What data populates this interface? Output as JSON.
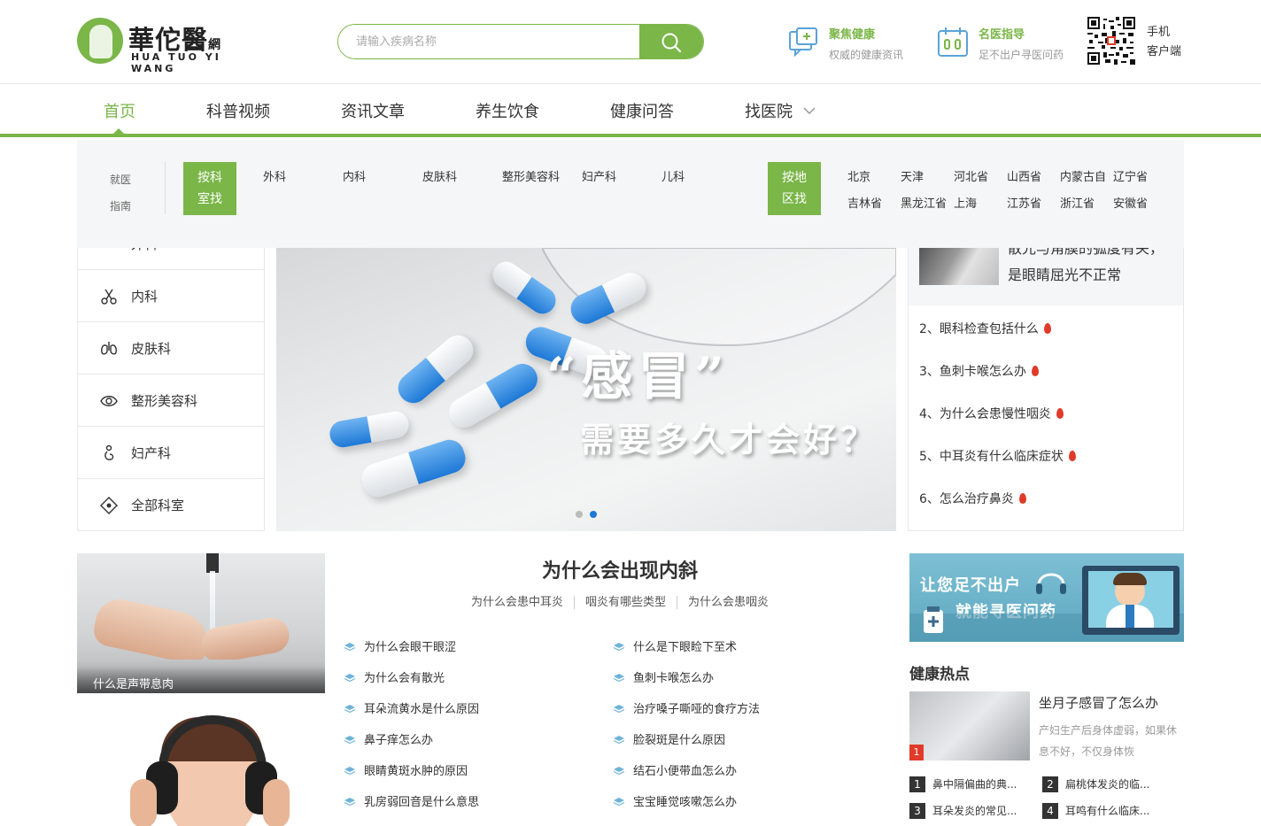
{
  "logo": {
    "cn": "華佗醫",
    "cn_suffix": "網",
    "en": "HUA TUO YI WANG"
  },
  "search": {
    "placeholder": "请输入疾病名称"
  },
  "header_features": [
    {
      "title": "聚焦健康",
      "subtitle": "权威的健康资讯"
    },
    {
      "title": "名医指导",
      "subtitle": "足不出户寻医问药"
    }
  ],
  "mobile": {
    "line1": "手机",
    "line2": "客户端"
  },
  "nav": {
    "items": [
      "首页",
      "科普视频",
      "资讯文章",
      "养生饮食",
      "健康问答",
      "找医院"
    ],
    "active_index": 0
  },
  "dropdown": {
    "guide_line1": "就医",
    "guide_line2": "指南",
    "dept_box_line1": "按科",
    "dept_box_line2": "室找",
    "departments": [
      "外科",
      "内科",
      "皮肤科",
      "整形美容科",
      "妇产科",
      "儿科"
    ],
    "area_box_line1": "按地",
    "area_box_line2": "区找",
    "areas_row1": [
      "北京",
      "天津",
      "河北省",
      "山西省",
      "内蒙古自",
      "辽宁省"
    ],
    "areas_row2": [
      "吉林省",
      "黑龙江省",
      "上海",
      "江苏省",
      "浙江省",
      "安徽省"
    ]
  },
  "left_menu": {
    "partial": "外科",
    "items": [
      "内科",
      "皮肤科",
      "整形美容科",
      "妇产科",
      "全部科室"
    ]
  },
  "banner": {
    "headline": "“感冒”",
    "subline": "需要多久才会好？",
    "active_dot": 1
  },
  "right_panel": {
    "top_text": "散光与角膜的弧度有关，是眼睛屈光不正常",
    "hot_items": [
      "2、眼科检查包括什么",
      "3、鱼刺卡喉怎么办",
      "4、为什么会患慢性咽炎",
      "5、中耳炎有什么临床症状",
      "6、怎么治疗鼻炎"
    ]
  },
  "image1": {
    "caption": "什么是声带息肉"
  },
  "article": {
    "title": "为什么会出现内斜",
    "tags": [
      "为什么会患中耳炎",
      "咽炎有哪些类型",
      "为什么会患咽炎"
    ],
    "left_links": [
      "为什么会眼干眼涩",
      "为什么会有散光",
      "耳朵流黄水是什么原因",
      "鼻子痒怎么办",
      "眼睛黄斑水肿的原因",
      "乳房弱回音是什么意思"
    ],
    "right_links": [
      "什么是下眼睑下至术",
      "鱼刺卡喉怎么办",
      "治疗嗓子嘶哑的食疗方法",
      "脸裂斑是什么原因",
      "结石小便带血怎么办",
      "宝宝睡觉咳嗽怎么办"
    ]
  },
  "ad": {
    "line1": "让您足不出户",
    "line2": "就能寻医问药"
  },
  "health_hot": {
    "heading": "健康热点",
    "badge": "1",
    "feature_title": "坐月子感冒了怎么办",
    "feature_desc": "产妇生产后身体虚弱，如果休息不好，不仅身体恢",
    "ranks": [
      {
        "n": "1",
        "t": "鼻中隔偏曲的典..."
      },
      {
        "n": "2",
        "t": "扁桃体发炎的临..."
      },
      {
        "n": "3",
        "t": "耳朵发炎的常见..."
      },
      {
        "n": "4",
        "t": "耳鸣有什么临床..."
      }
    ]
  },
  "colors": {
    "brand": "#7ab648",
    "flame": "#e03b2a",
    "ad_bg": "#6fb5cb"
  },
  "icons": [
    "search-icon",
    "chat-health-icon",
    "calendar-doctor-icon",
    "qr-code-icon",
    "scissors-icon",
    "lungs-icon",
    "eye-icon",
    "pregnancy-icon",
    "diamond-icon",
    "flame-icon",
    "chevron-down-icon",
    "layers-icon"
  ]
}
